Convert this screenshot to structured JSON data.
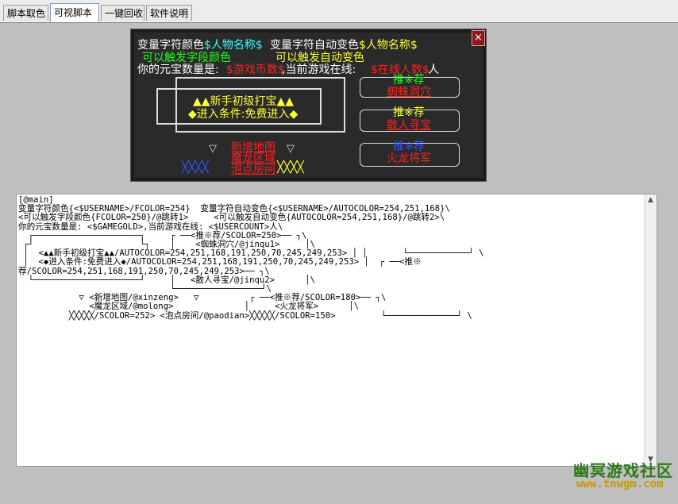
{
  "tabs": [
    "脚本取色",
    "可视脚本",
    "一键回收",
    "软件说明"
  ],
  "active_tab": 1,
  "preview": {
    "line1_a": "变量字符颜色",
    "line1_b": "$人物名称$",
    "line1_c": "变量字符自动变色",
    "line1_d": "$人物名称$",
    "trigger1": "可以触发字段颜色",
    "trigger2": "可以触发自动变色",
    "line3_a": "你的元宝数量是:",
    "line3_b": "$游戏币数$",
    "line3_c": ",当前游戏在线:",
    "line3_d": "$在线人数$",
    "line3_e": "人",
    "newbie_title": "▲▲新手初级打宝▲▲",
    "newbie_cond": "◆进入条件:免费进入◆",
    "rec1_title": "推※荐",
    "rec1_link": "蜘蛛洞穴",
    "rec2_title": "推※荐",
    "rec2_link": "散人寻宝",
    "rec3_title": "推※荐",
    "rec3_link": "火龙将军",
    "map1": "新增地图",
    "map2": "魔龙区域",
    "map3": "泡点房间",
    "close": "×"
  },
  "code": "[@main]\n变量字符颜色{<$USERNAME>/FCOLOR=254}  变量字符自动变色{<$USERNAME>/AUTOCOLOR=254,251,168}\\\n<可以触发字段颜色{FCOLOR=250}/@跳转1>     <可以触发自动变色{AUTOCOLOR=254,251,168}/@跳转2>\\\n你的元宝数量是: <$GAMEGOLD>,当前游戏在线: <$USERCOUNT>人\\\n  ┌─────────────────────┐     ┌ ──<推※荐/SCOLOR=250>── ┐\\\n ┌┘                     └┐    │    <蜘蛛洞穴/@jinqu1>     │\\\n │  <▲▲新手初级打宝▲▲/AUTOCOLOR=254,251,168,191,250,70,245,249,253> │ │       └────────────┘ \\\n │  <◆进入条件:免费进入◆/AUTOCOLOR=254,251,168,191,250,70,245,249,253> │  ┌ ──<推※\n荐/SCOLOR=254,251,168,191,250,70,245,249,253>── ┐\\\n  └─────────────────────┘     │   <散人寻宝/@jinqu2>      │\\\n                              └─────────────────┘\\\n            ▽ <新增地图/@xinzeng>   ▽          ┌ ──<推※荐/SCOLOR=180>── ┐\\\n              <魔龙区域/@molong>              │     <火龙将军>      │\\\n          ╳╳╳╳╳/SCOLOR=252> <泡点房间/@paodian>╳╳╳╳╳/SCOLOR=150>         └──────────────┘ \\",
  "watermark_cn": "幽冥游戏社区",
  "watermark_url": "www.tnwgm.com",
  "colors": {
    "cyan": "#33ffff",
    "yellow": "#ffff33",
    "green": "#22ff22",
    "red": "#ff2020",
    "blue": "#3355ff"
  }
}
